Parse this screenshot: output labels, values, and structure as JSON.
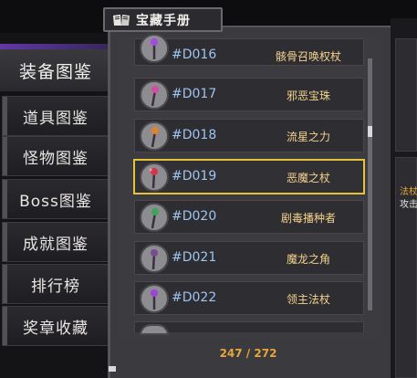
{
  "title": "宝藏手册",
  "nav": {
    "items": [
      {
        "label": "装备图鉴",
        "active": true
      },
      {
        "label": "道具图鉴"
      },
      {
        "label": "怪物图鉴"
      },
      {
        "label": "Boss图鉴"
      },
      {
        "label": "成就图鉴"
      },
      {
        "label": "排行榜"
      },
      {
        "label": "奖章收藏"
      }
    ]
  },
  "list": {
    "rows": [
      {
        "code": "#D016",
        "name": "骸骨召唤权杖",
        "icon": "purple-orb-staff-icon"
      },
      {
        "code": "#D017",
        "name": "邪恶宝珠",
        "icon": "pink-orb-staff-icon"
      },
      {
        "code": "#D018",
        "name": "流星之力",
        "icon": "orange-orb-staff-icon"
      },
      {
        "code": "#D019",
        "name": "恶魔之杖",
        "icon": "red-demon-staff-icon",
        "selected": true
      },
      {
        "code": "#D020",
        "name": "剧毒播种者",
        "icon": "green-poison-staff-icon"
      },
      {
        "code": "#D021",
        "name": "魔龙之角",
        "icon": "dark-dragon-staff-icon"
      },
      {
        "code": "#D022",
        "name": "领主法杖",
        "icon": "purple-lord-staff-icon"
      }
    ]
  },
  "footer": {
    "count": "247 / 272"
  },
  "detail": {
    "line1": "法杖",
    "line2": "攻击"
  },
  "colors": {
    "accent_gold": "#e4c23a",
    "code_blue": "#9ec4f0",
    "name_gold": "#f4d38c",
    "count_orange": "#e8a53a"
  }
}
